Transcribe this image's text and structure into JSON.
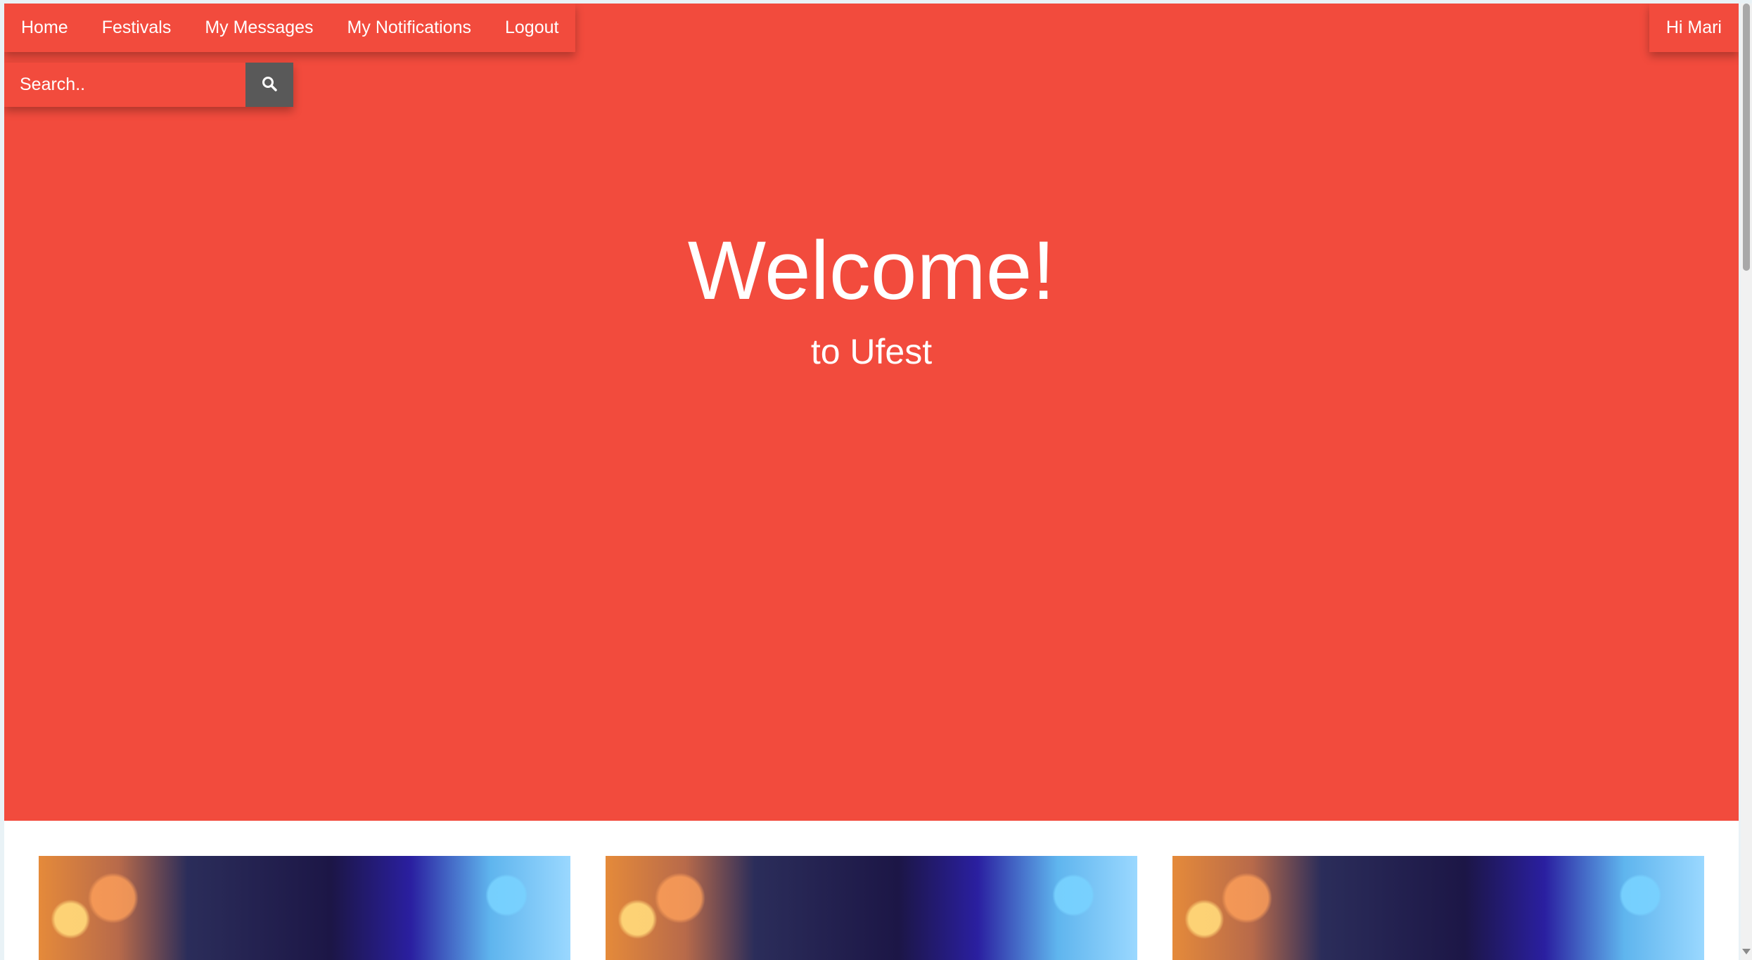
{
  "navbar": {
    "items": [
      {
        "label": "Home"
      },
      {
        "label": "Festivals"
      },
      {
        "label": "My Messages"
      },
      {
        "label": "My Notifications"
      },
      {
        "label": "Logout"
      }
    ],
    "greeting": "Hi Mari"
  },
  "search": {
    "placeholder": "Search..",
    "button_icon": "search-icon"
  },
  "hero": {
    "title": "Welcome!",
    "subtitle": "to Ufest"
  },
  "cards": [
    {
      "image": "festival-performer-photo"
    },
    {
      "image": "festival-performer-photo"
    },
    {
      "image": "festival-performer-photo"
    }
  ],
  "colors": {
    "hero_background": "#f24b3d",
    "search_button": "#595959",
    "text": "#ffffff"
  }
}
